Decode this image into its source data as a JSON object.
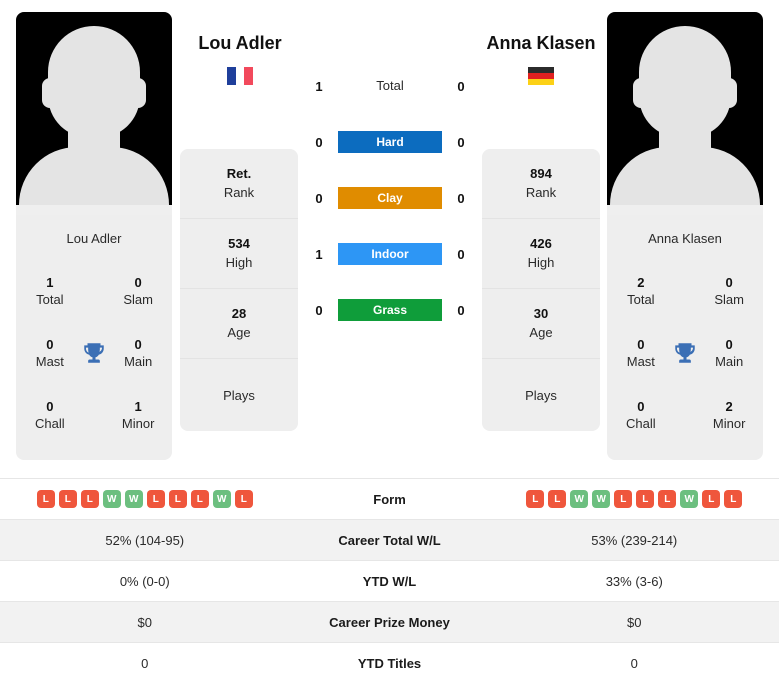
{
  "players": {
    "left": {
      "name": "Lou Adler",
      "card_name": "Lou Adler",
      "flag": "flag-france-icon",
      "titles": {
        "total_value": "1",
        "total_label": "Total",
        "slam_value": "0",
        "slam_label": "Slam",
        "mast_value": "0",
        "mast_label": "Mast",
        "main_value": "0",
        "main_label": "Main",
        "chall_value": "0",
        "chall_label": "Chall",
        "minor_value": "1",
        "minor_label": "Minor"
      },
      "info": [
        {
          "value": "Ret.",
          "label": "Rank"
        },
        {
          "value": "534",
          "label": "High"
        },
        {
          "value": "28",
          "label": "Age"
        },
        {
          "value": "",
          "label": "Plays"
        }
      ],
      "surface_wins": {
        "total": "1",
        "hard": "0",
        "clay": "0",
        "indoor": "1",
        "grass": "0"
      },
      "form": [
        "L",
        "L",
        "L",
        "W",
        "W",
        "L",
        "L",
        "L",
        "W",
        "L"
      ],
      "career_wl": "52% (104-95)",
      "ytd_wl": "0% (0-0)",
      "career_prize": "$0",
      "ytd_titles": "0"
    },
    "right": {
      "name": "Anna Klasen",
      "card_name": "Anna Klasen",
      "flag": "flag-germany-icon",
      "titles": {
        "total_value": "2",
        "total_label": "Total",
        "slam_value": "0",
        "slam_label": "Slam",
        "mast_value": "0",
        "mast_label": "Mast",
        "main_value": "0",
        "main_label": "Main",
        "chall_value": "0",
        "chall_label": "Chall",
        "minor_value": "2",
        "minor_label": "Minor"
      },
      "info": [
        {
          "value": "894",
          "label": "Rank"
        },
        {
          "value": "426",
          "label": "High"
        },
        {
          "value": "30",
          "label": "Age"
        },
        {
          "value": "",
          "label": "Plays"
        }
      ],
      "surface_wins": {
        "total": "0",
        "hard": "0",
        "clay": "0",
        "indoor": "0",
        "grass": "0"
      },
      "form": [
        "L",
        "L",
        "W",
        "W",
        "L",
        "L",
        "L",
        "W",
        "L",
        "L"
      ],
      "career_wl": "53% (239-214)",
      "ytd_wl": "33% (3-6)",
      "career_prize": "$0",
      "ytd_titles": "0"
    }
  },
  "surfaces": [
    {
      "key": "total",
      "label": "Total",
      "color": "transparent"
    },
    {
      "key": "hard",
      "label": "Hard",
      "color": "#0c6cbf"
    },
    {
      "key": "clay",
      "label": "Clay",
      "color": "#e08c00"
    },
    {
      "key": "indoor",
      "label": "Indoor",
      "color": "#2d96f5"
    },
    {
      "key": "grass",
      "label": "Grass",
      "color": "#0f9d3a"
    }
  ],
  "table_labels": {
    "form": "Form",
    "career_wl": "Career Total W/L",
    "ytd_wl": "YTD W/L",
    "career_prize": "Career Prize Money",
    "ytd_titles": "YTD Titles"
  },
  "colors": {
    "win": "#6cbf7f",
    "loss": "#ef563c",
    "trophy": "#3b6fb5",
    "card_bg": "#eeeeee",
    "row_alt": "#f2f2f2"
  }
}
